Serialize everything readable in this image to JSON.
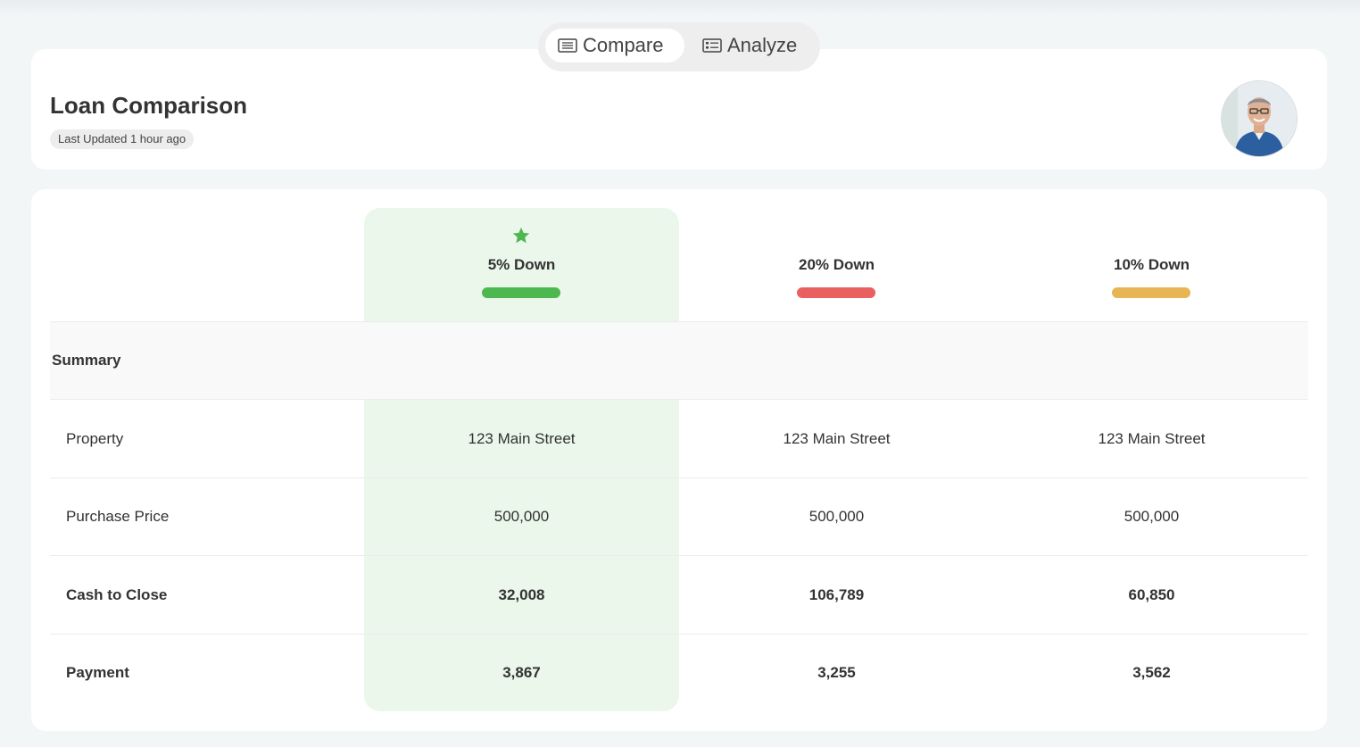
{
  "toggle": {
    "compare_label": "Compare",
    "analyze_label": "Analyze",
    "active": "compare"
  },
  "header": {
    "title": "Loan Comparison",
    "updated": "Last Updated 1 hour ago"
  },
  "table": {
    "columns": [
      {
        "label": "5% Down",
        "color": "#4cb84f",
        "favorite": true
      },
      {
        "label": "20% Down",
        "color": "#e86060",
        "favorite": false
      },
      {
        "label": "10% Down",
        "color": "#e8b555",
        "favorite": false
      }
    ],
    "summary_label": "Summary",
    "rows": [
      {
        "label": "Property",
        "values": [
          "123 Main Street",
          "123 Main Street",
          "123 Main Street"
        ]
      },
      {
        "label": "Purchase Price",
        "values": [
          "500,000",
          "500,000",
          "500,000"
        ]
      },
      {
        "label": "Cash to Close",
        "values": [
          "32,008",
          "106,789",
          "60,850"
        ]
      },
      {
        "label": "Payment",
        "values": [
          "3,867",
          "3,255",
          "3,562"
        ]
      }
    ]
  },
  "colors": {
    "highlight_bg": "#eaf7ea",
    "star": "#4cb84f"
  }
}
